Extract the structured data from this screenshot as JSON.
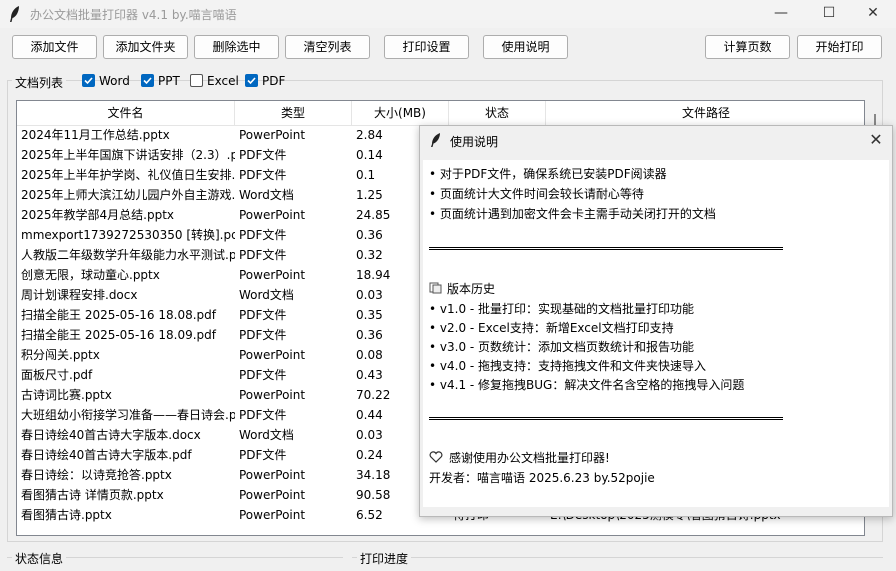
{
  "window": {
    "title": "办公文档批量打印器 v4.1 by.喵言喵语",
    "minimize_glyph": "—",
    "maximize_glyph": "☐",
    "close_glyph": "✕"
  },
  "toolbar": {
    "add_file": "添加文件",
    "add_folder": "添加文件夹",
    "remove_selected": "删除选中",
    "clear_list": "清空列表",
    "print_settings": "打印设置",
    "help": "使用说明",
    "count_pages": "计算页数",
    "start_print": "开始打印"
  },
  "filters": {
    "label": "文档列表",
    "items": [
      {
        "label": "Word",
        "checked": true
      },
      {
        "label": "PPT",
        "checked": true
      },
      {
        "label": "Excel",
        "checked": false
      },
      {
        "label": "PDF",
        "checked": true
      }
    ]
  },
  "table": {
    "columns": [
      "文件名",
      "类型",
      "大小(MB)",
      "状态",
      "文件路径"
    ],
    "rows": [
      [
        "2024年11月工作总结.pptx",
        "PowerPoint",
        "2.84",
        "",
        ""
      ],
      [
        "2025年上半年国旗下讲话安排（2.3）.pdf",
        "PDF文件",
        "0.14",
        "",
        ""
      ],
      [
        "2025年上半年护学岗、礼仪值日生安排.pdf",
        "PDF文件",
        "0.1",
        "",
        ""
      ],
      [
        "2025年上师大滨江幼儿园户外自主游戏.docx",
        "Word文档",
        "1.25",
        "",
        ""
      ],
      [
        "2025年教学部4月总结.pptx",
        "PowerPoint",
        "24.85",
        "",
        ""
      ],
      [
        "mmexport1739272530350 [转换].pdf",
        "PDF文件",
        "0.36",
        "",
        ""
      ],
      [
        "人教版二年级数学升年级能力水平测试.pdf",
        "PDF文件",
        "0.32",
        "",
        ""
      ],
      [
        "创意无限，球动童心.pptx",
        "PowerPoint",
        "18.94",
        "",
        ""
      ],
      [
        "周计划课程安排.docx",
        "Word文档",
        "0.03",
        "",
        ""
      ],
      [
        "扫描全能王 2025-05-16 18.08.pdf",
        "PDF文件",
        "0.35",
        "",
        ""
      ],
      [
        "扫描全能王 2025-05-16 18.09.pdf",
        "PDF文件",
        "0.36",
        "",
        ""
      ],
      [
        "积分闯关.pptx",
        "PowerPoint",
        "0.08",
        "",
        ""
      ],
      [
        "面板尺寸.pdf",
        "PDF文件",
        "0.43",
        "",
        ""
      ],
      [
        "古诗词比赛.pptx",
        "PowerPoint",
        "70.22",
        "",
        ""
      ],
      [
        "大班组幼小衔接学习准备——春日诗会.pdf",
        "PDF文件",
        "0.44",
        "",
        ""
      ],
      [
        "春日诗绘40首古诗大字版本.docx",
        "Word文档",
        "0.03",
        "",
        ""
      ],
      [
        "春日诗绘40首古诗大字版本.pdf",
        "PDF文件",
        "0.24",
        "",
        ""
      ],
      [
        "春日诗绘：以诗竞抢答.pptx",
        "PowerPoint",
        "34.18",
        "",
        ""
      ],
      [
        "看图猜古诗 详情页款.pptx",
        "PowerPoint",
        "90.58",
        "",
        ""
      ],
      [
        "看图猜古诗.pptx",
        "PowerPoint",
        "6.52",
        "待打印",
        "E:\\Desktop\\2025测模专\\看图猜古诗.pptx"
      ]
    ]
  },
  "bottom": {
    "status_label": "状态信息",
    "progress_label": "打印进度"
  },
  "dialog": {
    "title": "使用说明",
    "tips": [
      "• 对于PDF文件，确保系统已安装PDF阅读器",
      "• 页面统计大文件时间会较长请耐心等待",
      "• 页面统计遇到加密文件会卡主需手动关闭打开的文档"
    ],
    "history_title": "版本历史",
    "history": [
      "• v1.0 - 批量打印：实现基础的文档批量打印功能",
      "• v2.0 - Excel支持：新增Excel文档打印支持",
      "• v3.0 - 页数统计：添加文档页数统计和报告功能",
      "• v4.0 - 拖拽支持：支持拖拽文件和文件夹快速导入",
      "• v4.1 - 修复拖拽BUG：解决文件名含空格的拖拽导入问题"
    ],
    "thanks": "感谢使用办公文档批量打印器!",
    "developer": "开发者：喵言喵语 2025.6.23 by.52pojie"
  }
}
